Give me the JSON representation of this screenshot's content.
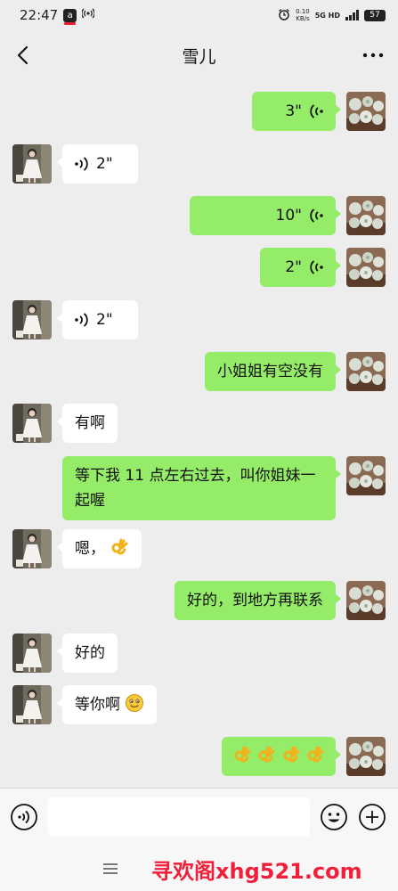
{
  "status_bar": {
    "time": "22:47",
    "app_badge": "a",
    "speed_value": "0.10",
    "speed_unit": "KB/s",
    "network": "5G HD",
    "battery": "57"
  },
  "header": {
    "title": "雪儿"
  },
  "messages": [
    {
      "side": "mine",
      "type": "voice",
      "duration": "3\""
    },
    {
      "side": "theirs",
      "type": "voice",
      "duration": "2\""
    },
    {
      "side": "mine",
      "type": "voice",
      "duration": "10\""
    },
    {
      "side": "mine",
      "type": "voice",
      "duration": "2\""
    },
    {
      "side": "theirs",
      "type": "voice",
      "duration": "2\""
    },
    {
      "side": "mine",
      "type": "text",
      "text": "小姐姐有空没有"
    },
    {
      "side": "theirs",
      "type": "text",
      "text": "有啊"
    },
    {
      "side": "mine",
      "type": "text",
      "text": "等下我 11 点左右过去，叫你姐妹一起喔"
    },
    {
      "side": "theirs",
      "type": "text",
      "text": "嗯，",
      "emoji": "ok-hand-emoji"
    },
    {
      "side": "mine",
      "type": "text",
      "text": "好的，到地方再联系"
    },
    {
      "side": "theirs",
      "type": "text",
      "text": "好的"
    },
    {
      "side": "theirs",
      "type": "text",
      "text": "等你啊",
      "emoji": "smile-emoji"
    },
    {
      "side": "mine",
      "type": "emoji",
      "emoji": "ok-hand-emoji",
      "count": 4
    }
  ],
  "input": {
    "value": "",
    "placeholder": ""
  },
  "watermark": "寻欢阁xhg521.com",
  "colors": {
    "background": "#ededed",
    "my_bubble": "#95ec69",
    "their_bubble": "#ffffff",
    "watermark": "#f1203a"
  },
  "icons": {
    "back": "chevron-left-icon",
    "more": "more-dots-icon",
    "voice_toggle": "voice-icon",
    "emoji": "emoji-icon",
    "plus": "plus-icon",
    "menu": "menu-icon"
  }
}
